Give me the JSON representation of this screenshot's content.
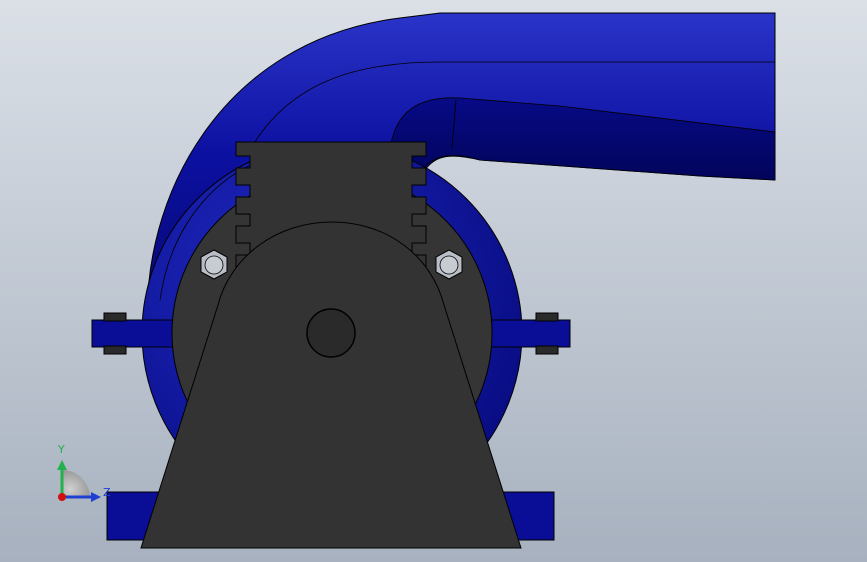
{
  "colors": {
    "background_top": "#d9dee6",
    "background_bottom": "#a9b3c1",
    "casing": "#0b0f9a",
    "casing_dark": "#050872",
    "casing_light": "#2430c8",
    "bracket": "#333333",
    "edge": "#000000",
    "bolt": "#b8bcc4",
    "axis_y": "#22b14c",
    "axis_z": "#1f3fd0",
    "axis_x": "#d01010"
  },
  "triad": {
    "y_label": "Y",
    "z_label": "Z"
  }
}
